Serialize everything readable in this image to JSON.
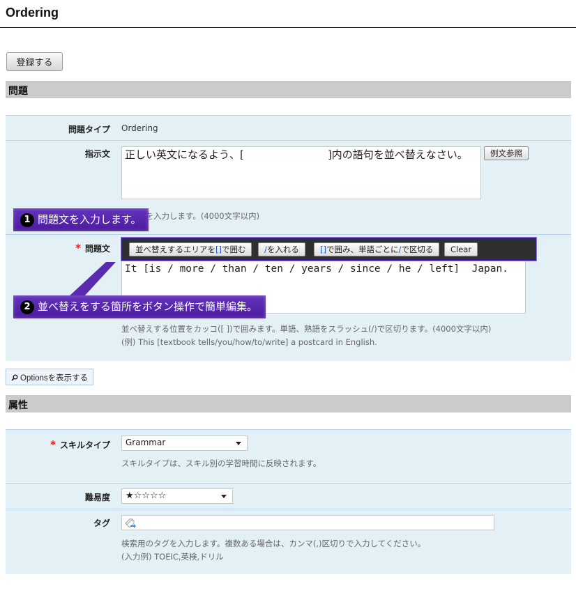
{
  "header": {
    "title": "Ordering"
  },
  "actions": {
    "register_label": "登録する",
    "options_label": "Optionsを表示する"
  },
  "sections": {
    "question": "問題",
    "attributes": "属性"
  },
  "question": {
    "type_label": "問題タイプ",
    "type_value": "Ordering",
    "instruction_label": "指示文",
    "instruction_value": "正しい英文になるよう、[　　　　　　　　]内の語句を並べ替えなさい。",
    "instruction_hint": "指示文を入力します。(4000文字以内)",
    "example_button": "例文参照",
    "body_label": "問題文",
    "body_value": "It [is / more / than / ten / years / since / he / left]  Japan.",
    "toolbar": {
      "btn1_a": "並べ替えするエリアを",
      "btn1_b": "[]",
      "btn1_c": "で囲む",
      "btn2_a": "/",
      "btn2_b": "を入れる",
      "btn3_a": "[]",
      "btn3_b": "で囲み、単語ごとに",
      "btn3_c": "/",
      "btn3_d": "で区切る",
      "clear": "Clear"
    },
    "body_hint_1": "並べ替えする位置をカッコ([ ])で囲みます。単語、熟語をスラッシュ(/)で区切ります。(4000文字以内)",
    "body_hint_2": "(例) This [textbook tells/you/how/to/write] a postcard in English."
  },
  "callouts": {
    "c1_num": "1",
    "c1_text": "問題文を入力します。",
    "c2_num": "2",
    "c2_text": "並べ替えをする箇所をボタン操作で簡単編集。"
  },
  "attributes": {
    "skill_label": "スキルタイプ",
    "skill_value": "Grammar",
    "skill_hint": "スキルタイプは、スキル別の学習時間に反映されます。",
    "difficulty_label": "難易度",
    "difficulty_value": "★☆☆☆☆",
    "difficulty_level": 1,
    "difficulty_max": 5,
    "tag_label": "タグ",
    "tag_value": "",
    "tag_hint_1": "検索用のタグを入力します。複数ある場合は、カンマ(,)区切りで入力してください。",
    "tag_hint_2": "(入力例) TOEIC,英検,ドリル"
  },
  "colors": {
    "accent_purple": "#4a1c9e",
    "required": "#e02020",
    "form_bg": "#e3f0f5",
    "section_bg": "#cbcbcb"
  }
}
